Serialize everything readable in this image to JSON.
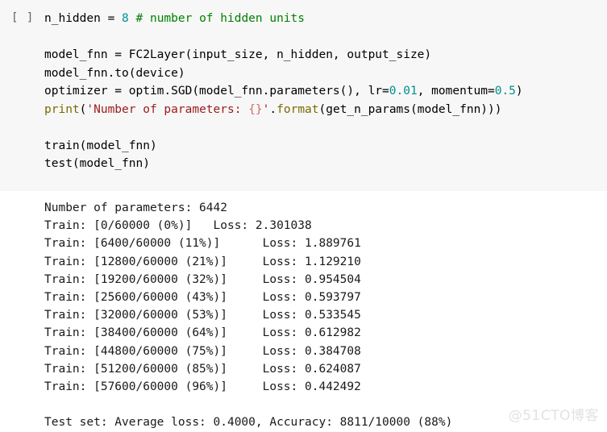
{
  "notebook": {
    "cell_marker": "[ ]",
    "code_background": "#f7f7f7",
    "output_background": "#ffffff",
    "colors": {
      "identifier": "#000000",
      "number": "#008f8f",
      "comment": "#007f00",
      "builtin_function": "#7a6a00",
      "string": "#9c1b1b",
      "format_placeholder": "#cf6a6a",
      "cell_marker": "#5f5f5f",
      "watermark": "#e2e2e2"
    },
    "code_lines": [
      {
        "id": "line-n-hidden",
        "tokens": [
          {
            "text": "n_hidden = ",
            "type": "plain"
          },
          {
            "text": "8",
            "type": "num"
          },
          {
            "text": " ",
            "type": "plain"
          },
          {
            "text": "# number of hidden units",
            "type": "comment"
          }
        ]
      },
      {
        "id": "line-blank-1",
        "tokens": []
      },
      {
        "id": "line-model-fnn",
        "tokens": [
          {
            "text": "model_fnn = FC2Layer(input_size, n_hidden, output_size)",
            "type": "plain"
          }
        ]
      },
      {
        "id": "line-model-to-device",
        "tokens": [
          {
            "text": "model_fnn.to(device)",
            "type": "plain"
          }
        ]
      },
      {
        "id": "line-optimizer",
        "tokens": [
          {
            "text": "optimizer = optim.SGD(model_fnn.parameters(), lr=",
            "type": "plain"
          },
          {
            "text": "0.01",
            "type": "num"
          },
          {
            "text": ", momentum=",
            "type": "plain"
          },
          {
            "text": "0.5",
            "type": "num"
          },
          {
            "text": ")",
            "type": "plain"
          }
        ]
      },
      {
        "id": "line-print",
        "tokens": [
          {
            "text": "print",
            "type": "func"
          },
          {
            "text": "(",
            "type": "plain"
          },
          {
            "text": "'Number of parameters: ",
            "type": "str"
          },
          {
            "text": "{}",
            "type": "fmt"
          },
          {
            "text": "'",
            "type": "str"
          },
          {
            "text": ".",
            "type": "plain"
          },
          {
            "text": "format",
            "type": "func"
          },
          {
            "text": "(get_n_params(model_fnn)))",
            "type": "plain"
          }
        ]
      },
      {
        "id": "line-blank-2",
        "tokens": []
      },
      {
        "id": "line-train-call",
        "tokens": [
          {
            "text": "train(model_fnn)",
            "type": "plain"
          }
        ]
      },
      {
        "id": "line-test-call",
        "tokens": [
          {
            "text": "test(model_fnn)",
            "type": "plain"
          }
        ]
      }
    ],
    "output_lines": [
      {
        "id": "out-num-params",
        "text": "Number of parameters: 6442"
      },
      {
        "id": "out-train-0",
        "text": "Train: [0/60000 (0%)]   Loss: 2.301038"
      },
      {
        "id": "out-train-1",
        "text": "Train: [6400/60000 (11%)]      Loss: 1.889761"
      },
      {
        "id": "out-train-2",
        "text": "Train: [12800/60000 (21%)]     Loss: 1.129210"
      },
      {
        "id": "out-train-3",
        "text": "Train: [19200/60000 (32%)]     Loss: 0.954504"
      },
      {
        "id": "out-train-4",
        "text": "Train: [25600/60000 (43%)]     Loss: 0.593797"
      },
      {
        "id": "out-train-5",
        "text": "Train: [32000/60000 (53%)]     Loss: 0.533545"
      },
      {
        "id": "out-train-6",
        "text": "Train: [38400/60000 (64%)]     Loss: 0.612982"
      },
      {
        "id": "out-train-7",
        "text": "Train: [44800/60000 (75%)]     Loss: 0.384708"
      },
      {
        "id": "out-train-8",
        "text": "Train: [51200/60000 (85%)]     Loss: 0.624087"
      },
      {
        "id": "out-train-9",
        "text": "Train: [57600/60000 (96%)]     Loss: 0.442492"
      },
      {
        "id": "out-blank",
        "text": ""
      },
      {
        "id": "out-test-set",
        "text": "Test set: Average loss: 0.4000, Accuracy: 8811/10000 (88%)"
      }
    ],
    "training_log": {
      "num_parameters": 6442,
      "total_train_samples": 60000,
      "entries": [
        {
          "seen": 0,
          "percent": 0,
          "loss": 2.301038
        },
        {
          "seen": 6400,
          "percent": 11,
          "loss": 1.889761
        },
        {
          "seen": 12800,
          "percent": 21,
          "loss": 1.12921
        },
        {
          "seen": 19200,
          "percent": 32,
          "loss": 0.954504
        },
        {
          "seen": 25600,
          "percent": 43,
          "loss": 0.593797
        },
        {
          "seen": 32000,
          "percent": 53,
          "loss": 0.533545
        },
        {
          "seen": 38400,
          "percent": 64,
          "loss": 0.612982
        },
        {
          "seen": 44800,
          "percent": 75,
          "loss": 0.384708
        },
        {
          "seen": 51200,
          "percent": 85,
          "loss": 0.624087
        },
        {
          "seen": 57600,
          "percent": 96,
          "loss": 0.442492
        }
      ],
      "test": {
        "average_loss": 0.4,
        "correct": 8811,
        "total": 10000,
        "accuracy_percent": 88
      }
    },
    "watermark": "@51CTO博客"
  }
}
